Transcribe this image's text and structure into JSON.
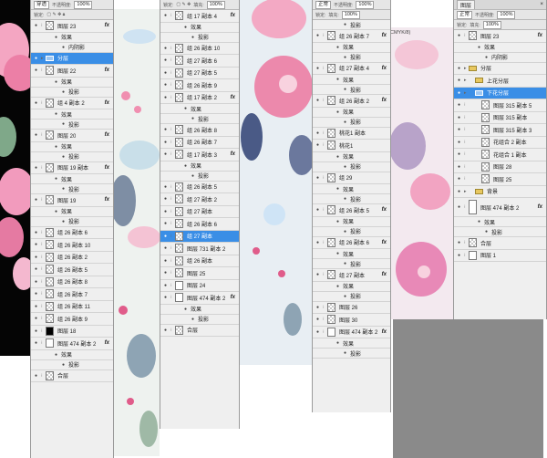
{
  "panel1": {
    "blend": "穿透",
    "opacity_label": "不透明度:",
    "opacity": "100%",
    "lock_label": "锁定:",
    "rows": [
      {
        "kind": "layer",
        "label": "图层 23",
        "fx": true
      },
      {
        "kind": "sub",
        "label": "效果"
      },
      {
        "kind": "sub2",
        "label": "内阴影"
      },
      {
        "kind": "group",
        "label": "分层",
        "selected": true
      },
      {
        "kind": "layer",
        "label": "图层 22",
        "fx": true
      },
      {
        "kind": "sub",
        "label": "效果"
      },
      {
        "kind": "sub2",
        "label": "投影"
      },
      {
        "kind": "layer",
        "label": "组 4 副本 2",
        "fx": true
      },
      {
        "kind": "sub",
        "label": "效果"
      },
      {
        "kind": "sub2",
        "label": "投影"
      },
      {
        "kind": "layer",
        "label": "图层 20",
        "fx": true
      },
      {
        "kind": "sub",
        "label": "效果"
      },
      {
        "kind": "sub2",
        "label": "投影"
      },
      {
        "kind": "layer",
        "label": "图层 19 副本",
        "fx": true
      },
      {
        "kind": "sub",
        "label": "效果"
      },
      {
        "kind": "sub2",
        "label": "投影"
      },
      {
        "kind": "layer",
        "label": "图层 19",
        "fx": true
      },
      {
        "kind": "sub",
        "label": "效果"
      },
      {
        "kind": "sub2",
        "label": "投影"
      },
      {
        "kind": "layer",
        "label": "组 26 副本 6"
      },
      {
        "kind": "layer",
        "label": "组 26 副本 10"
      },
      {
        "kind": "layer",
        "label": "组 26 副本 2"
      },
      {
        "kind": "layer",
        "label": "组 26 副本 5"
      },
      {
        "kind": "layer",
        "label": "组 26 副本 8"
      },
      {
        "kind": "layer",
        "label": "组 26 副本 7"
      },
      {
        "kind": "layer",
        "label": "组 26 副本 11"
      },
      {
        "kind": "layer",
        "label": "组 26 副本 9"
      },
      {
        "kind": "layer",
        "label": "图层 18",
        "thumb": "black"
      },
      {
        "kind": "layer",
        "label": "图层 474 副本 2",
        "fx": true,
        "thumb": "white"
      },
      {
        "kind": "sub",
        "label": "效果"
      },
      {
        "kind": "sub2",
        "label": "投影"
      },
      {
        "kind": "layer",
        "label": "合层"
      }
    ]
  },
  "panel2": {
    "lock_label": "锁定:",
    "fill_label": "填充:",
    "fill": "100%",
    "rows": [
      {
        "kind": "layer",
        "label": "组 17 副本 4",
        "fx": true
      },
      {
        "kind": "sub",
        "label": "效果"
      },
      {
        "kind": "sub2",
        "label": "投影"
      },
      {
        "kind": "layer",
        "label": "组 26 副本 10"
      },
      {
        "kind": "layer",
        "label": "组 27 副本 6"
      },
      {
        "kind": "layer",
        "label": "组 27 副本 5"
      },
      {
        "kind": "layer",
        "label": "组 26 副本 9"
      },
      {
        "kind": "layer",
        "label": "组 17 副本 2",
        "fx": true
      },
      {
        "kind": "sub",
        "label": "效果"
      },
      {
        "kind": "sub2",
        "label": "投影"
      },
      {
        "kind": "layer",
        "label": "组 26 副本 8"
      },
      {
        "kind": "layer",
        "label": "组 26 副本 7"
      },
      {
        "kind": "layer",
        "label": "组 17 副本 3",
        "fx": true
      },
      {
        "kind": "sub",
        "label": "效果"
      },
      {
        "kind": "sub2",
        "label": "投影"
      },
      {
        "kind": "layer",
        "label": "组 26 副本 5"
      },
      {
        "kind": "layer",
        "label": "组 27 副本 2"
      },
      {
        "kind": "layer",
        "label": "组 27 副本"
      },
      {
        "kind": "layer",
        "label": "组 26 副本 6"
      },
      {
        "kind": "layer",
        "label": "组 27 副本",
        "selected": true
      },
      {
        "kind": "layer",
        "label": "图层 731 副本 2"
      },
      {
        "kind": "layer",
        "label": "组 26 副本"
      },
      {
        "kind": "layer",
        "label": "图层 25"
      },
      {
        "kind": "layer",
        "label": "图层 24",
        "thumb": "white"
      },
      {
        "kind": "layer",
        "label": "图层 474 副本 2",
        "fx": true,
        "thumb": "white"
      },
      {
        "kind": "sub",
        "label": "效果"
      },
      {
        "kind": "sub2",
        "label": "投影"
      },
      {
        "kind": "layer",
        "label": "合层"
      }
    ]
  },
  "panel3": {
    "blend": "正常",
    "opacity_label": "不透明度:",
    "opacity": "100%",
    "lock_label": "锁定:",
    "fill_label": "填充:",
    "fill": "100%",
    "rows": [
      {
        "kind": "sub2",
        "label": "投影"
      },
      {
        "kind": "layer",
        "label": "组 26 副本 7",
        "fx": true
      },
      {
        "kind": "sub",
        "label": "效果"
      },
      {
        "kind": "sub2",
        "label": "投影"
      },
      {
        "kind": "layer",
        "label": "组 27 副本 4",
        "fx": true
      },
      {
        "kind": "sub",
        "label": "效果"
      },
      {
        "kind": "sub2",
        "label": "投影"
      },
      {
        "kind": "layer",
        "label": "组 26 副本 2",
        "fx": true
      },
      {
        "kind": "sub",
        "label": "效果"
      },
      {
        "kind": "sub2",
        "label": "投影"
      },
      {
        "kind": "layer",
        "label": "桃花1 副本"
      },
      {
        "kind": "layer",
        "label": "桃花1"
      },
      {
        "kind": "sub",
        "label": "效果"
      },
      {
        "kind": "sub2",
        "label": "投影"
      },
      {
        "kind": "layer",
        "label": "组 29"
      },
      {
        "kind": "sub",
        "label": "效果"
      },
      {
        "kind": "sub2",
        "label": "投影"
      },
      {
        "kind": "layer",
        "label": "组 26 副本 5",
        "fx": true
      },
      {
        "kind": "sub",
        "label": "效果"
      },
      {
        "kind": "sub2",
        "label": "投影"
      },
      {
        "kind": "layer",
        "label": "组 26 副本 6",
        "fx": true
      },
      {
        "kind": "sub",
        "label": "效果"
      },
      {
        "kind": "sub2",
        "label": "投影"
      },
      {
        "kind": "layer",
        "label": "组 27 副本",
        "fx": true
      },
      {
        "kind": "sub",
        "label": "效果"
      },
      {
        "kind": "sub2",
        "label": "投影"
      },
      {
        "kind": "layer",
        "label": "图层 26"
      },
      {
        "kind": "layer",
        "label": "图层 30"
      },
      {
        "kind": "layer",
        "label": "图层 474 副本 2",
        "fx": true,
        "thumb": "white"
      },
      {
        "kind": "sub",
        "label": "效果"
      },
      {
        "kind": "sub2",
        "label": "投影"
      }
    ]
  },
  "panel4": {
    "tab": "图层",
    "blend": "正常",
    "opacity_label": "不透明度:",
    "opacity": "100%",
    "lock_label": "锁定:",
    "fill_label": "填充:",
    "fill": "100%",
    "rows": [
      {
        "kind": "layer",
        "label": "图层 23",
        "fx": true
      },
      {
        "kind": "sub",
        "label": "效果"
      },
      {
        "kind": "sub2",
        "label": "内阴影"
      },
      {
        "kind": "group",
        "label": "分层"
      },
      {
        "kind": "group",
        "label": "上花分层",
        "indent": 1
      },
      {
        "kind": "group",
        "label": "下花分层",
        "indent": 1,
        "selected": true
      },
      {
        "kind": "layer",
        "label": "图层 315 副本 5",
        "indent": 2
      },
      {
        "kind": "layer",
        "label": "图层 315 副本",
        "indent": 2
      },
      {
        "kind": "layer",
        "label": "图层 315 副本 3",
        "indent": 2
      },
      {
        "kind": "layer",
        "label": "花组合 2 副本",
        "indent": 2
      },
      {
        "kind": "layer",
        "label": "花组合 1 副本",
        "indent": 2
      },
      {
        "kind": "layer",
        "label": "图层 28",
        "indent": 2
      },
      {
        "kind": "layer",
        "label": "图层 25",
        "indent": 2
      },
      {
        "kind": "group",
        "label": "背景",
        "indent": 1
      },
      {
        "kind": "layer",
        "label": "图层 474 副本 2",
        "fx": true,
        "thumb": "white",
        "tall": true
      },
      {
        "kind": "sub",
        "label": "效果"
      },
      {
        "kind": "sub2",
        "label": "投影"
      },
      {
        "kind": "layer",
        "label": "合层"
      },
      {
        "kind": "layer",
        "label": "图层 1",
        "thumb": "white"
      }
    ]
  },
  "canvas": {
    "mode_label": "CMYK/8)"
  },
  "colors": {
    "highlight": "#3a8ee6",
    "petal_pink": "#f08fb0",
    "deep_pink": "#d8477a",
    "leaf_green": "#8fb79a",
    "navy_leaf": "#4a5a86"
  }
}
